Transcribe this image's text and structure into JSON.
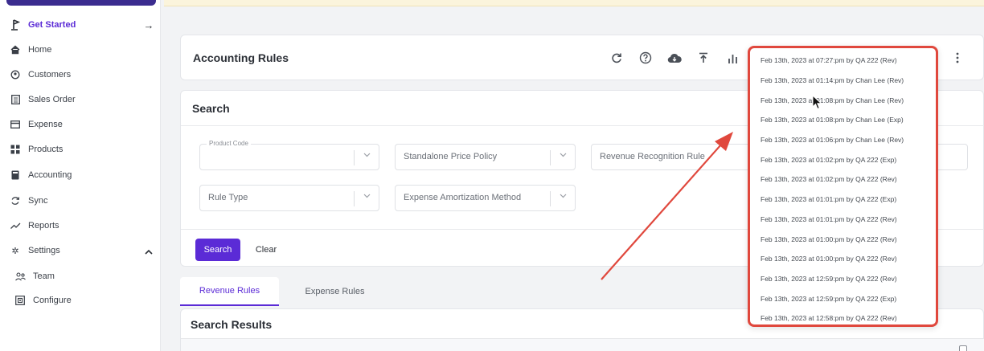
{
  "sidebar": {
    "get_started": "Get Started",
    "items": [
      {
        "label": "Home",
        "icon": "home-icon"
      },
      {
        "label": "Customers",
        "icon": "customers-icon"
      },
      {
        "label": "Sales Order",
        "icon": "sales-order-icon"
      },
      {
        "label": "Expense",
        "icon": "expense-icon"
      },
      {
        "label": "Products",
        "icon": "products-icon"
      },
      {
        "label": "Accounting",
        "icon": "accounting-icon"
      },
      {
        "label": "Sync",
        "icon": "sync-icon"
      },
      {
        "label": "Reports",
        "icon": "reports-icon"
      },
      {
        "label": "Settings",
        "icon": "gear-icon"
      }
    ],
    "sub_items": [
      {
        "label": "Team",
        "icon": "team-icon"
      },
      {
        "label": "Configure",
        "icon": "configure-icon"
      }
    ]
  },
  "header": {
    "title": "Accounting Rules"
  },
  "search": {
    "title": "Search",
    "product_code_label": "Product Code",
    "standalone_price_policy": "Standalone Price Policy",
    "revenue_recognition_rule": "Revenue Recognition Rule",
    "rule_type": "Rule Type",
    "expense_amortization_method": "Expense Amortization Method",
    "search_button": "Search",
    "clear_button": "Clear"
  },
  "tabs": {
    "revenue_rules": "Revenue Rules",
    "expense_rules": "Expense Rules"
  },
  "results": {
    "title": "Search Results"
  },
  "version_history": [
    "Feb 13th, 2023 at 07:27:pm by QA 222 (Rev)",
    "Feb 13th, 2023 at 01:14:pm by Chan Lee (Rev)",
    "Feb 13th, 2023 at 01:08:pm by Chan Lee (Rev)",
    "Feb 13th, 2023 at 01:08:pm by Chan Lee (Exp)",
    "Feb 13th, 2023 at 01:06:pm by Chan Lee (Rev)",
    "Feb 13th, 2023 at 01:02:pm by QA 222 (Exp)",
    "Feb 13th, 2023 at 01:02:pm by QA 222 (Rev)",
    "Feb 13th, 2023 at 01:01:pm by QA 222 (Exp)",
    "Feb 13th, 2023 at 01:01:pm by QA 222 (Rev)",
    "Feb 13th, 2023 at 01:00:pm by QA 222 (Rev)",
    "Feb 13th, 2023 at 01:00:pm by QA 222 (Rev)",
    "Feb 13th, 2023 at 12:59:pm by QA 222 (Rev)",
    "Feb 13th, 2023 at 12:59:pm by QA 222 (Exp)",
    "Feb 13th, 2023 at 12:58:pm by QA 222 (Rev)"
  ],
  "colors": {
    "accent": "#5b2bd6",
    "annotation": "#e0483d",
    "notice": "#fbf4dc"
  }
}
